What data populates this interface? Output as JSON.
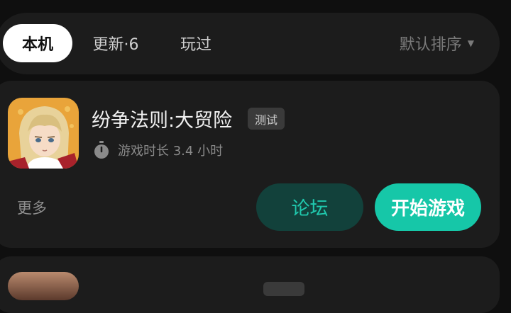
{
  "tabs": [
    {
      "label": "本机",
      "active": true
    },
    {
      "label": "更新·6",
      "active": false
    },
    {
      "label": "玩过",
      "active": false
    }
  ],
  "sort": {
    "label": "默认排序"
  },
  "game": {
    "title": "纷争法则:大贸险",
    "badge": "测试",
    "playtime": "游戏时长 3.4 小时",
    "more_label": "更多",
    "forum_label": "论坛",
    "start_label": "开始游戏"
  },
  "game2": {
    "title_partial": "",
    "badge": ""
  },
  "colors": {
    "background": "#0f0f0f",
    "card": "#1c1c1c",
    "accent": "#16c7a8",
    "forum_bg": "#12413b"
  }
}
